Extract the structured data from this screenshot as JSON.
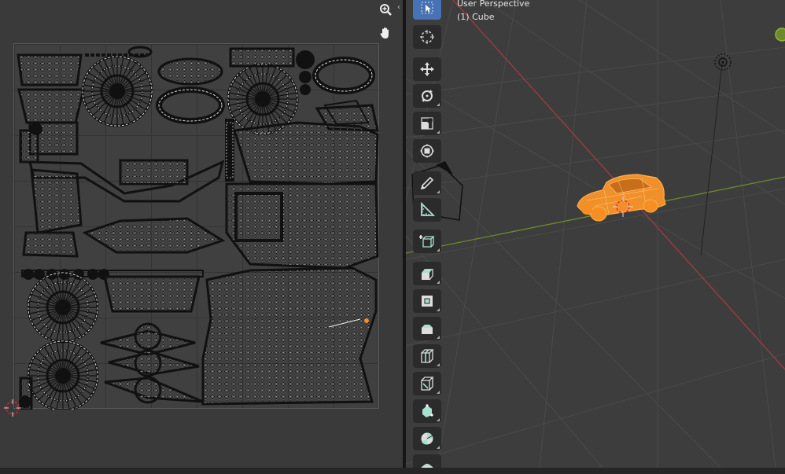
{
  "viewport": {
    "title": "User Perspective",
    "object": "(1) Cube"
  },
  "uv_editor": {
    "nav_icons": [
      "zoom-icon",
      "hand-pan-icon"
    ]
  },
  "toolbar": {
    "tools": [
      {
        "name": "select-tool",
        "icon": "cursor-icon",
        "active": true
      },
      {
        "name": "cursor-tool",
        "icon": "crosshair-icon",
        "active": false
      },
      {
        "name": "move-tool",
        "icon": "move-icon",
        "active": false
      },
      {
        "name": "rotate-tool",
        "icon": "rotate-icon",
        "active": false
      },
      {
        "name": "scale-tool",
        "icon": "scale-icon",
        "active": false
      },
      {
        "name": "transform-tool",
        "icon": "transform-icon",
        "active": false
      },
      {
        "name": "annotate-tool",
        "icon": "pencil-icon",
        "active": false
      },
      {
        "name": "measure-tool",
        "icon": "ruler-icon",
        "active": false
      },
      {
        "name": "add-cube-tool",
        "icon": "add-cube-icon",
        "active": false
      },
      {
        "name": "extrude-tool",
        "icon": "extrude-icon",
        "active": false
      },
      {
        "name": "inset-tool",
        "icon": "inset-icon",
        "active": false
      },
      {
        "name": "bevel-tool",
        "icon": "bevel-icon",
        "active": false
      },
      {
        "name": "loop-cut-tool",
        "icon": "loop-cut-icon",
        "active": false
      },
      {
        "name": "knife-tool",
        "icon": "knife-icon",
        "active": false
      },
      {
        "name": "poly-build-tool",
        "icon": "poly-build-icon",
        "active": false
      },
      {
        "name": "spin-tool",
        "icon": "spin-icon",
        "active": false
      },
      {
        "name": "smooth-tool",
        "icon": "smooth-icon",
        "active": false
      }
    ]
  },
  "colors": {
    "accent": "#4772b3",
    "selection": "#f0902a",
    "x_axis": "#a23c44",
    "y_axis": "#6c8a2c",
    "tool_icon_teal": "#a8e0cf"
  }
}
